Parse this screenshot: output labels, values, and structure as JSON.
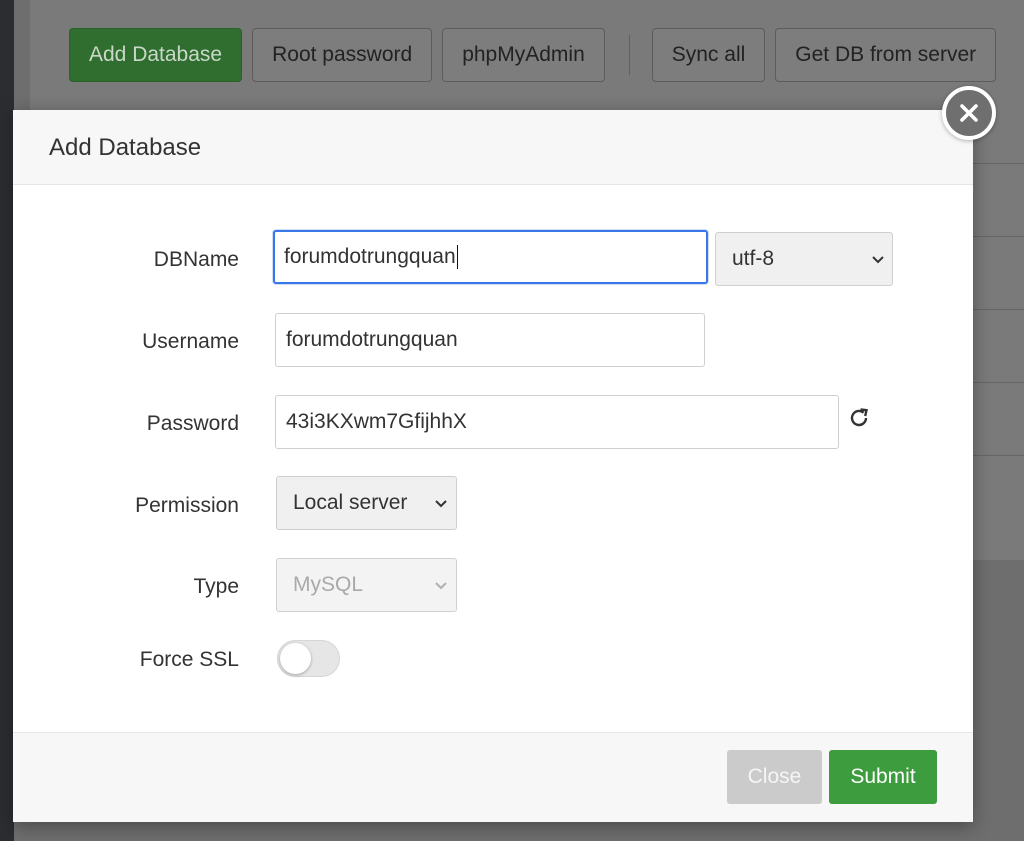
{
  "toolbar": {
    "add_database": "Add Database",
    "root_password": "Root password",
    "phpmyadmin": "phpMyAdmin",
    "sync_all": "Sync all",
    "get_db_from_server": "Get DB from server"
  },
  "modal": {
    "title": "Add Database",
    "fields": {
      "dbname": {
        "label": "DBName",
        "value": "forumdotrungquan"
      },
      "charset": {
        "value": "utf-8"
      },
      "username": {
        "label": "Username",
        "value": "forumdotrungquan"
      },
      "password": {
        "label": "Password",
        "value": "43i3KXwm7GfijhhX"
      },
      "permission": {
        "label": "Permission",
        "value": "Local server"
      },
      "type": {
        "label": "Type",
        "value": "MySQL"
      },
      "force_ssl": {
        "label": "Force SSL",
        "enabled": false
      }
    },
    "buttons": {
      "close": "Close",
      "submit": "Submit"
    }
  },
  "icons": {
    "dismiss": "close-icon",
    "refresh": "refresh-icon",
    "dropdown": "chevron-down-icon"
  },
  "colors": {
    "primary_green": "#3d9c3d",
    "focus_blue": "#3b78e7",
    "overlay": "#6e6e6e"
  }
}
